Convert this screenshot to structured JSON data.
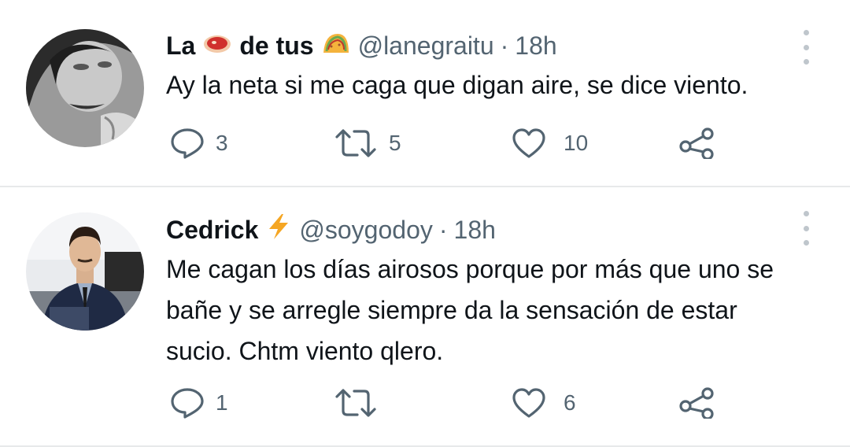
{
  "tweets": [
    {
      "name_part1": "La",
      "name_part2": "de tus",
      "handle": "@lanegraitu",
      "separator": "·",
      "time": "18h",
      "text": "Ay la neta si me caga que digan aire, se dice viento.",
      "replies": "3",
      "retweets": "5",
      "likes": "10"
    },
    {
      "name": "Cedrick",
      "handle": "@soygodoy",
      "separator": "·",
      "time": "18h",
      "text_lines": [
        "Me cagan los días airosos porque por más que uno se",
        "bañe y se arregle siempre da la sensación de estar",
        "sucio. Chtm viento qlero."
      ],
      "replies": "1",
      "retweets": "",
      "likes": "6"
    }
  ],
  "icons": {
    "emoji_1": "meat-emoji",
    "emoji_2": "taco-emoji",
    "emoji_3": "lightning-emoji",
    "reply": "reply-icon",
    "retweet": "retweet-icon",
    "like": "heart-icon",
    "share": "share-icon",
    "more": "more-icon"
  },
  "colors": {
    "text": "#0f1419",
    "secondary": "#536471",
    "divider": "#e7e9ea",
    "lightning": "#f5a623"
  }
}
